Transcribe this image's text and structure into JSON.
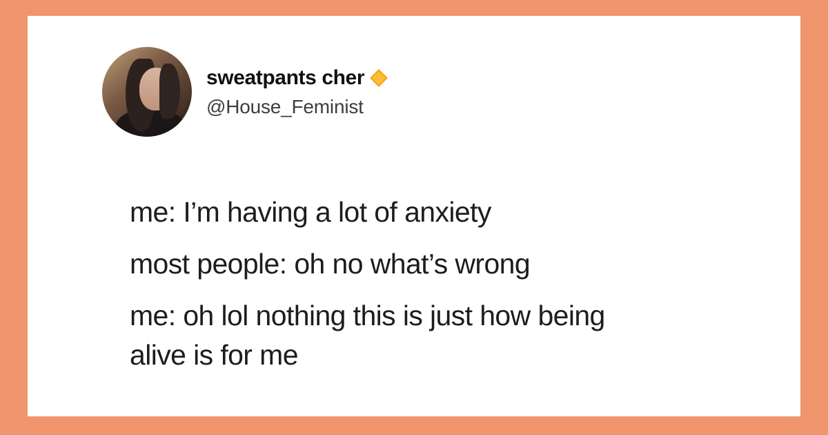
{
  "colors": {
    "background": "#f0956d",
    "card": "#ffffff",
    "text": "#1d1d1d",
    "handle": "#3d3d3d",
    "verified": "#f7a319"
  },
  "tweet": {
    "author": {
      "display_name": "sweatpants cher",
      "handle": "@House_Feminist",
      "avatar_icon": "profile-photo",
      "badge_icon": "verified-diamond-icon"
    },
    "lines": [
      "me: I’m having a lot of anxiety",
      "most people: oh no what’s wrong",
      "me: oh lol nothing this is just how being",
      "alive is for me"
    ]
  }
}
